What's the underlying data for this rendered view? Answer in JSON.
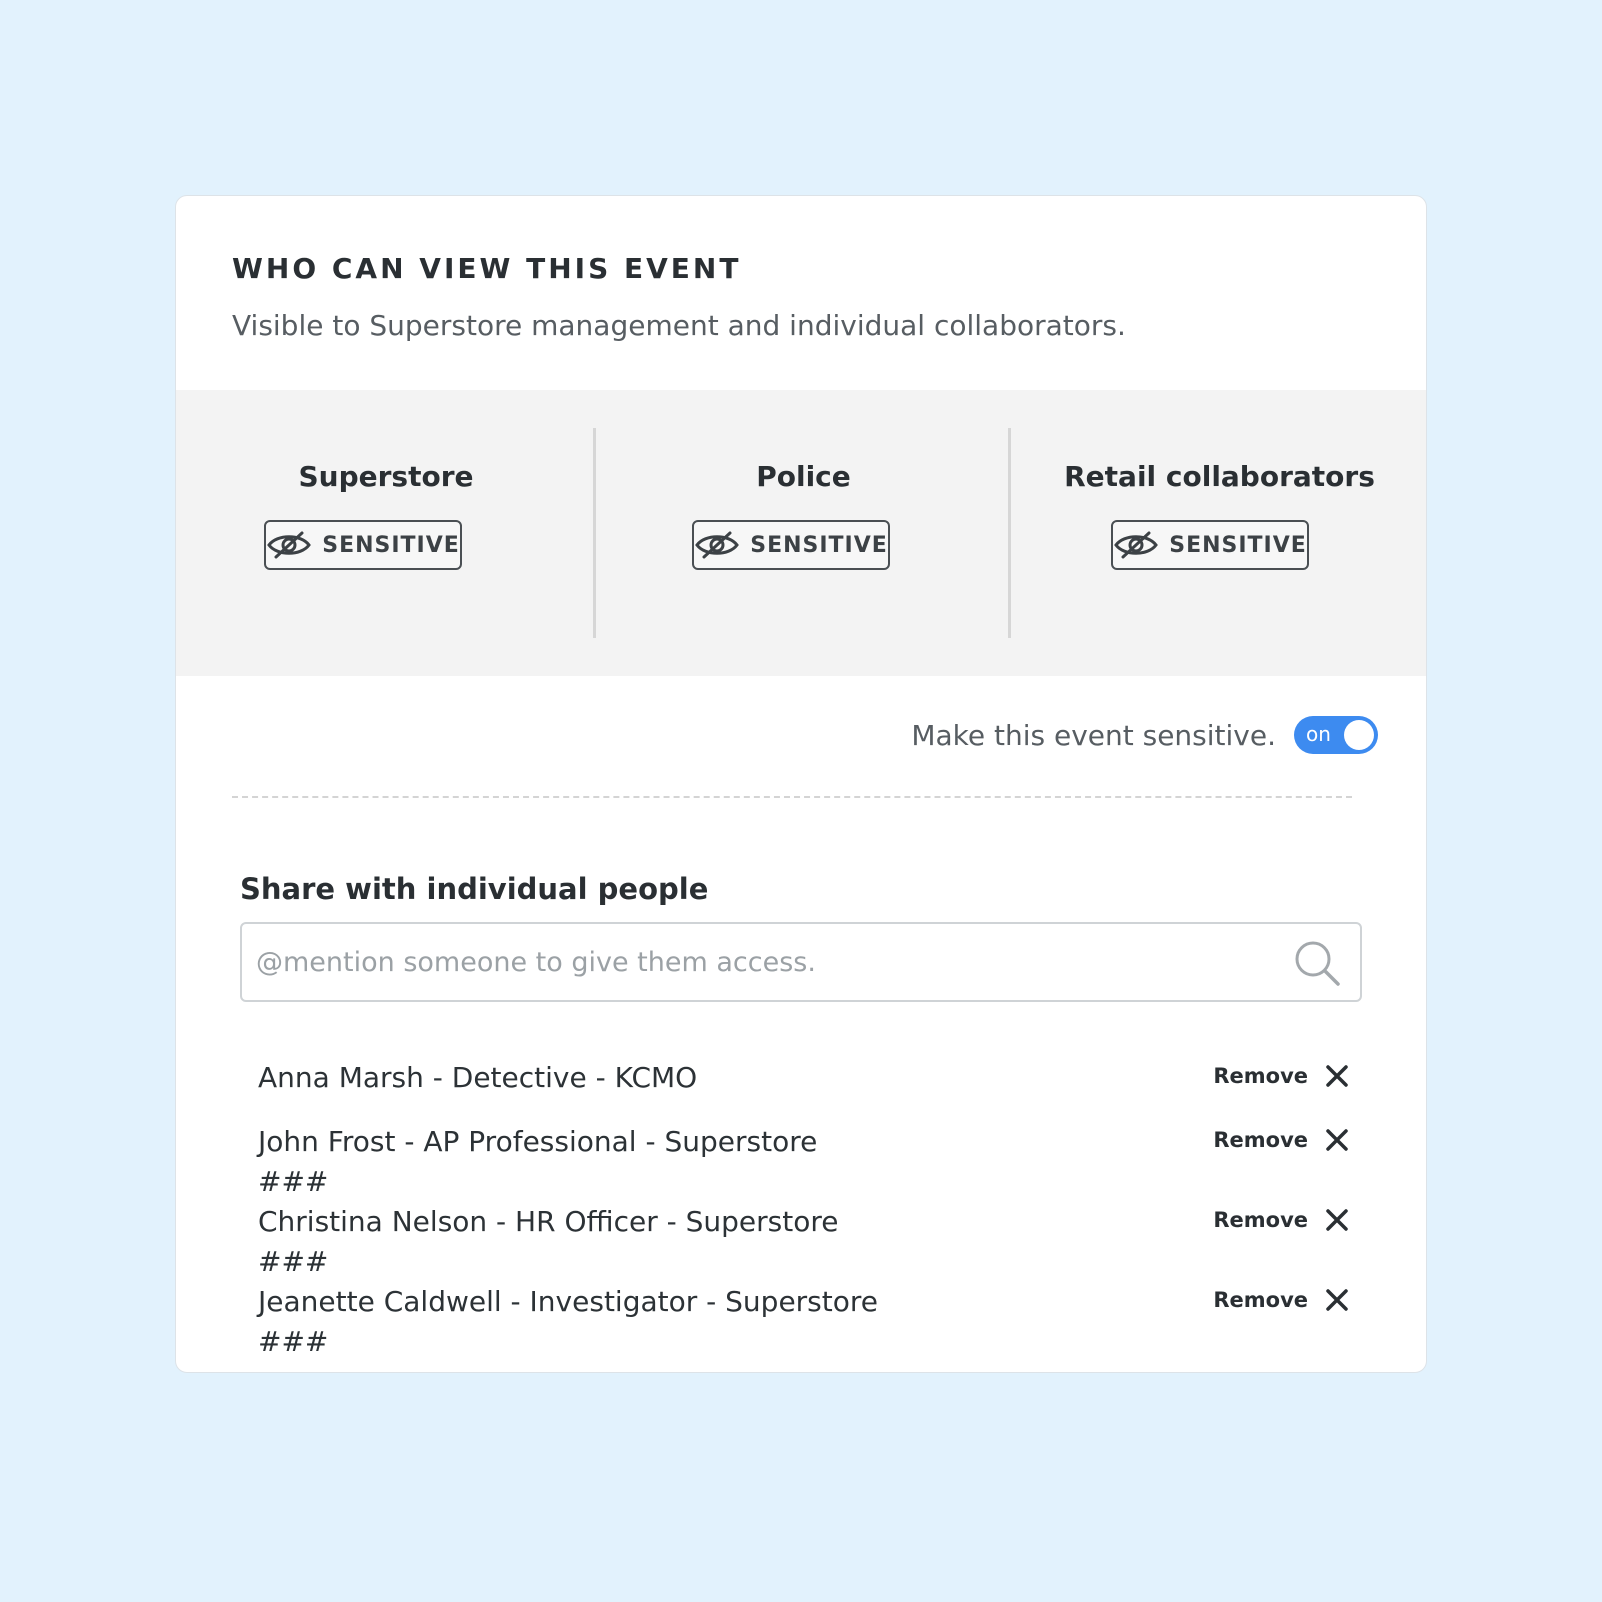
{
  "panel": {
    "title": "WHO CAN VIEW THIS EVENT",
    "subtitle": "Visible to Superstore management and individual collaborators."
  },
  "groups": [
    {
      "name": "Superstore",
      "badge_label": "SENSITIVE",
      "badge_icon": "eye-slash-icon"
    },
    {
      "name": "Police",
      "badge_label": "SENSITIVE",
      "badge_icon": "eye-slash-icon"
    },
    {
      "name": "Retail collaborators",
      "badge_label": "SENSITIVE",
      "badge_icon": "eye-slash-icon"
    }
  ],
  "sensitive_toggle": {
    "label": "Make this event sensitive.",
    "state_text": "on",
    "checked": true,
    "color": "#3d8bf0"
  },
  "share": {
    "heading": "Share with individual people",
    "search_placeholder": "@mention someone to give them access.",
    "search_value": "",
    "search_icon": "search-icon",
    "people": [
      {
        "name": "Anna Marsh - Detective - KCMO",
        "remove_label": "Remove"
      },
      {
        "name": "John Frost - AP Professional - Superstore ###",
        "remove_label": "Remove"
      },
      {
        "name": "Christina Nelson - HR Officer - Superstore ###",
        "remove_label": "Remove"
      },
      {
        "name": "Jeanette Caldwell - Investigator - Superstore ###",
        "remove_label": "Remove"
      }
    ]
  },
  "colors": {
    "page_background": "#e2f2fd",
    "card_background": "#ffffff",
    "groups_background": "#f3f3f3",
    "accent": "#3d8bf0"
  }
}
